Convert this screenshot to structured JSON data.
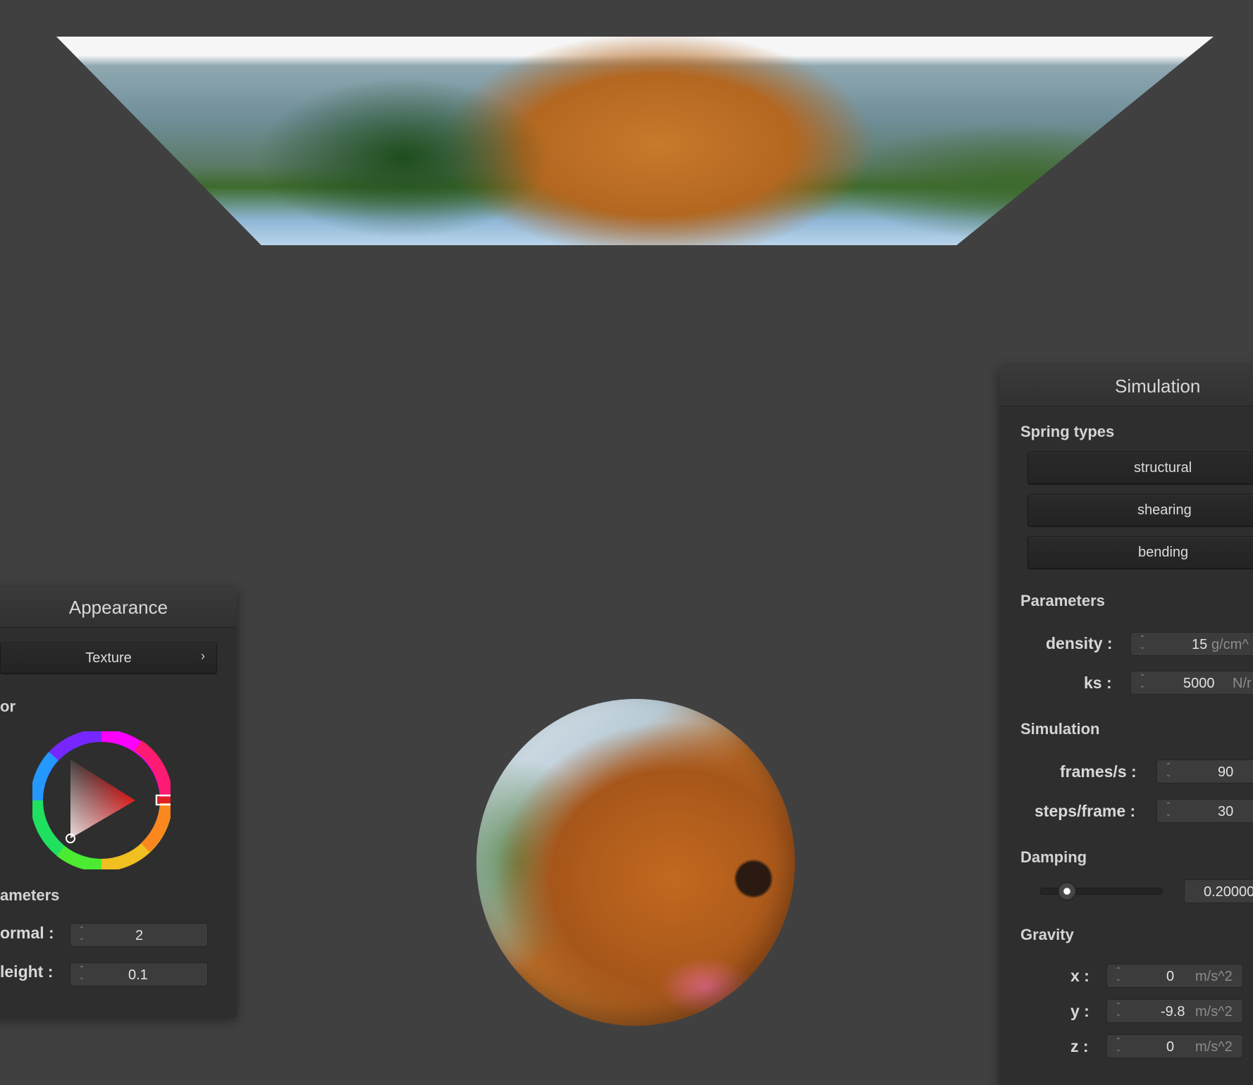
{
  "appearance": {
    "title": "Appearance",
    "texture_button": "Texture",
    "texture_chevron": "›",
    "color_section": "or",
    "parameters_section": "ameters",
    "normal_label": "ormal :",
    "normal_value": "2",
    "height_label": "leight :",
    "height_value": "0.1",
    "color_wheel_selected": "#e02020"
  },
  "simulation": {
    "title": "Simulation",
    "spring_types_section": "Spring types",
    "spring_buttons": [
      "structural",
      "shearing",
      "bending"
    ],
    "parameters_section": "Parameters",
    "density_label": "density :",
    "density_value": "15",
    "density_unit": "g/cm^",
    "ks_label": "ks :",
    "ks_value": "5000",
    "ks_unit": "N/r",
    "simulation_section": "Simulation",
    "fps_label": "frames/s :",
    "fps_value": "90",
    "steps_label": "steps/frame :",
    "steps_value": "30",
    "damping_section": "Damping",
    "damping_value": "0.20000",
    "damping_slider_fraction": 0.2,
    "gravity_section": "Gravity",
    "gx_label": "x :",
    "gx_value": "0",
    "gy_label": "y :",
    "gy_value": "-9.8",
    "gz_label": "z :",
    "gz_value": "0",
    "gravity_unit": "m/s^2"
  }
}
